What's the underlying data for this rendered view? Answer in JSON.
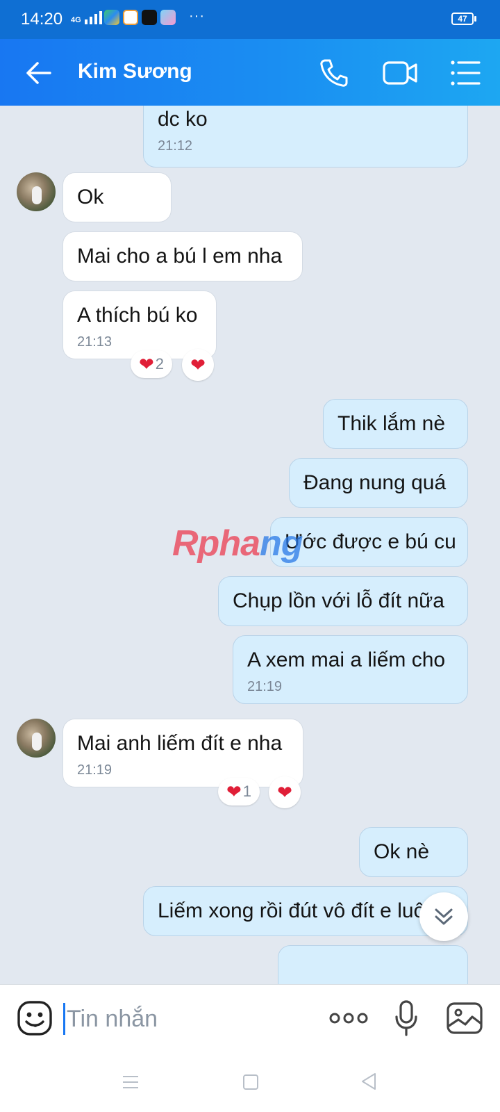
{
  "status_bar": {
    "time": "14:20",
    "network": "4G",
    "dots": "···",
    "battery": "47"
  },
  "header": {
    "title": "Kim Sương",
    "icons": [
      "back-arrow-icon",
      "phone-icon",
      "video-call-icon",
      "menu-list-icon"
    ],
    "color": "#1877f2"
  },
  "messages": [
    {
      "id": "m1",
      "dir": "out",
      "text": "dc ko",
      "time": "21:12"
    },
    {
      "id": "m2",
      "dir": "in",
      "text": "Ok"
    },
    {
      "id": "m3",
      "dir": "in",
      "text": "Mai cho a bú l em nha"
    },
    {
      "id": "m4",
      "dir": "in",
      "text": "A thích bú ko",
      "time": "21:13",
      "reaction_count": "2"
    },
    {
      "id": "m5",
      "dir": "out",
      "text": "Thik lắm nè"
    },
    {
      "id": "m6",
      "dir": "out",
      "text": "Đang nung quá"
    },
    {
      "id": "m7",
      "dir": "out",
      "text": "Ước được e bú cu"
    },
    {
      "id": "m8",
      "dir": "out",
      "text": "Chụp lồn với lỗ đít nữa"
    },
    {
      "id": "m9",
      "dir": "out",
      "text": "A xem mai a liếm cho",
      "time": "21:19"
    },
    {
      "id": "m10",
      "dir": "in",
      "text": "Mai anh liếm đít e nha",
      "time": "21:19",
      "reaction_count": "1"
    },
    {
      "id": "m11",
      "dir": "out",
      "text": "Ok nè"
    },
    {
      "id": "m12",
      "dir": "out",
      "text": "Liếm xong rồi đút vô đít e luôn"
    }
  ],
  "watermark": {
    "part1": "Rpha",
    "part2": "ng"
  },
  "input": {
    "placeholder": "Tin nhắn"
  },
  "colors": {
    "incoming_bubble": "#ffffff",
    "outgoing_bubble": "#d6eefd",
    "chat_background": "#e2e8f0",
    "heart": "#e01e37"
  }
}
